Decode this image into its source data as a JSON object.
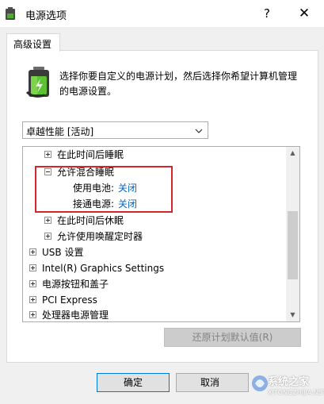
{
  "window": {
    "title": "电源选项",
    "help": "?",
    "close": "✕"
  },
  "tab": {
    "label": "高级设置"
  },
  "description": {
    "line1": "选择你要自定义的电源计划，然后选择你希望计算机管理",
    "line2": "的电源设置。"
  },
  "plan_select": {
    "value": "卓越性能 [活动]",
    "chevron": "⌄"
  },
  "tree": {
    "items": [
      {
        "label": "在此时间后睡眠"
      },
      {
        "label": "允许混合睡眠"
      },
      {
        "label": "使用电池:",
        "value": "关闭"
      },
      {
        "label": "接通电源:",
        "value": "关闭"
      },
      {
        "label": "在此时间后休眠"
      },
      {
        "label": "允许使用唤醒定时器"
      },
      {
        "label": "USB 设置"
      },
      {
        "label": "Intel(R) Graphics Settings"
      },
      {
        "label": "电源按钮和盖子"
      },
      {
        "label": "PCI Express"
      },
      {
        "label": "处理器电源管理"
      }
    ],
    "scroll_up": "▲",
    "scroll_down": "▼"
  },
  "buttons": {
    "restore": "还原计划默认值(R)",
    "ok": "确定",
    "cancel": "取消"
  },
  "watermark": {
    "text": "系统之家",
    "sub": "XITONGZHIJIA.NET"
  },
  "colors": {
    "highlight_border": "#d2282c",
    "link": "#0066cc",
    "accent": "#0078d7"
  }
}
